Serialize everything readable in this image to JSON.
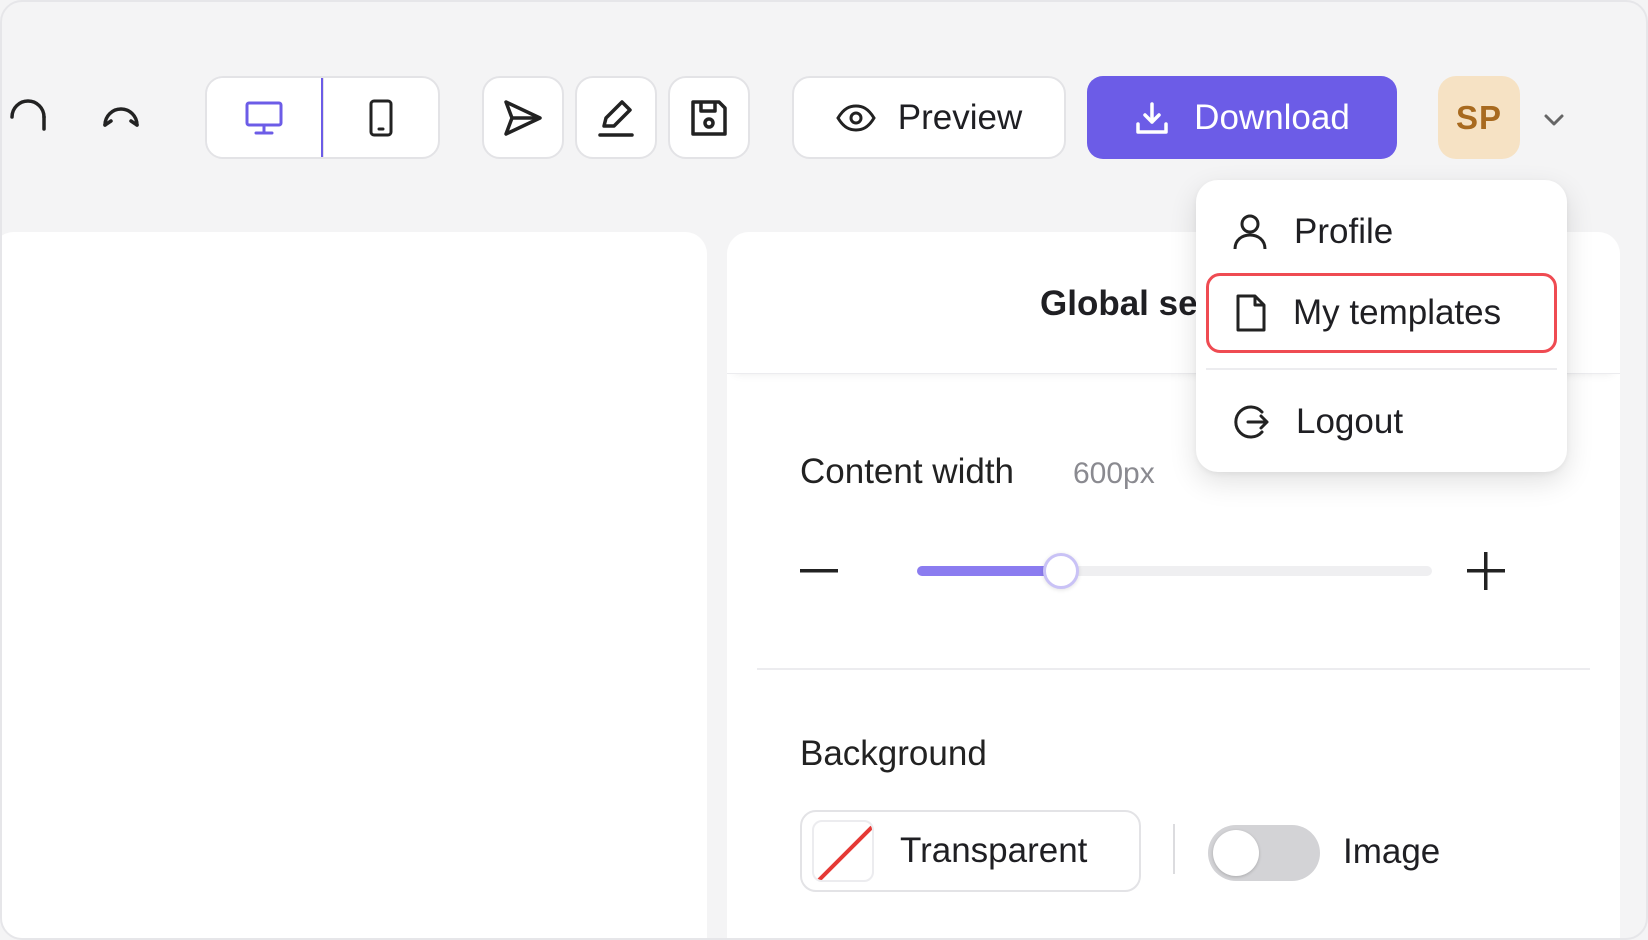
{
  "toolbar": {
    "undo_icon": "undo-icon",
    "redo_icon": "redo-icon",
    "device_toggle": [
      {
        "name": "desktop",
        "icon": "monitor-icon",
        "active": true
      },
      {
        "name": "mobile",
        "icon": "phone-icon",
        "active": false
      }
    ],
    "tools": [
      "send-icon",
      "pencil-icon",
      "save-icon"
    ],
    "preview_label": "Preview",
    "download_label": "Download",
    "avatar_initials": "SP",
    "accent_color": "#6c5ce7"
  },
  "user_menu": {
    "items": [
      {
        "label": "Profile",
        "icon": "user-icon"
      },
      {
        "label": "My templates",
        "icon": "document-icon",
        "highlighted": true
      },
      {
        "label": "Logout",
        "icon": "logout-icon"
      }
    ]
  },
  "settings": {
    "title": "Global se",
    "content_width": {
      "label": "Content width",
      "value": "600px",
      "slider_fraction": 0.28
    },
    "background": {
      "label": "Background",
      "transparent_label": "Transparent",
      "image_label": "Image",
      "image_enabled": false
    }
  }
}
